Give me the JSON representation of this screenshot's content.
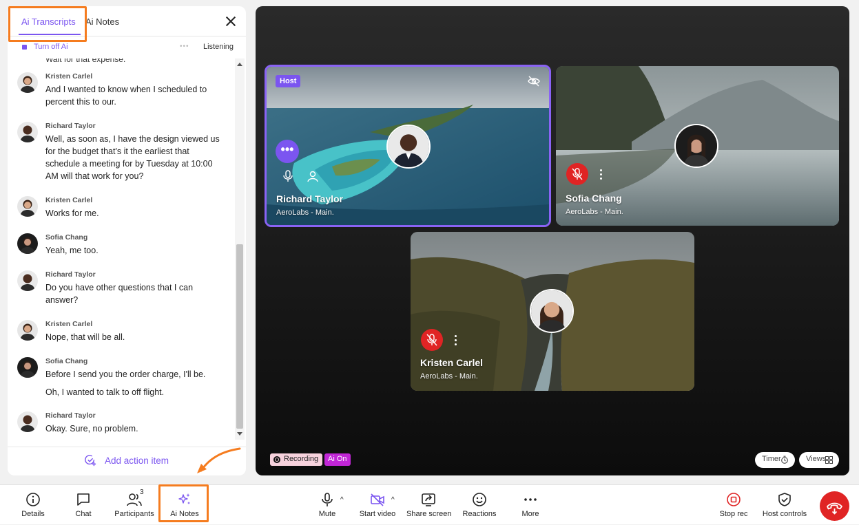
{
  "panel": {
    "tab_transcripts": "Ai Transcripts",
    "tab_notes": "Ai Notes",
    "turn_off": "Turn off Ai",
    "listening": "Listening",
    "partial_line": "Wait for that expense.",
    "messages": [
      {
        "name": "Kristen Carlel",
        "lines": [
          "And I wanted to know when I scheduled to",
          "percent this to our."
        ]
      },
      {
        "name": "Richard Taylor",
        "lines": [
          "Well, as soon as, I have the design viewed us",
          "for the budget that's it the earliest that",
          "schedule a meeting for by Tuesday at 10:00",
          "AM will that work for you?"
        ]
      },
      {
        "name": "Kristen Carlel",
        "lines": [
          "Works for me."
        ]
      },
      {
        "name": "Sofia Chang",
        "lines": [
          "Yeah, me too."
        ]
      },
      {
        "name": "Richard Taylor",
        "lines": [
          "Do you have other questions that I can",
          "answer?"
        ]
      },
      {
        "name": "Kristen Carlel",
        "lines": [
          "Nope, that will be all."
        ]
      },
      {
        "name": "Sofia Chang",
        "lines": [
          "Before I send you the order charge, I'll be.",
          "Oh, I wanted to talk to off flight."
        ]
      },
      {
        "name": "Richard Taylor",
        "lines": [
          "Okay. Sure, no problem."
        ]
      }
    ],
    "add_action": "Add action item"
  },
  "tiles": {
    "host_badge": "Host",
    "richard": {
      "name": "Richard Taylor",
      "org": "AeroLabs - Main."
    },
    "sofia": {
      "name": "Sofia Chang",
      "org": "AeroLabs - Main."
    },
    "kristen": {
      "name": "Kristen Carlel",
      "org": "AeroLabs - Main."
    }
  },
  "stage": {
    "recording": "Recording",
    "ai_on": "Ai On",
    "timer": "Timer",
    "views": "Views"
  },
  "toolbar": {
    "details": "Details",
    "chat": "Chat",
    "participants": "Participants",
    "participants_count": "3",
    "ai_notes": "Ai Notes",
    "mute": "Mute",
    "start_video": "Start video",
    "share_screen": "Share screen",
    "reactions": "Reactions",
    "more": "More",
    "stop_rec": "Stop rec",
    "host_controls": "Host controls"
  },
  "colors": {
    "accent": "#7b55f0",
    "highlight": "#f57c1f",
    "danger": "#e02424",
    "ai_on": "#c126d6"
  }
}
